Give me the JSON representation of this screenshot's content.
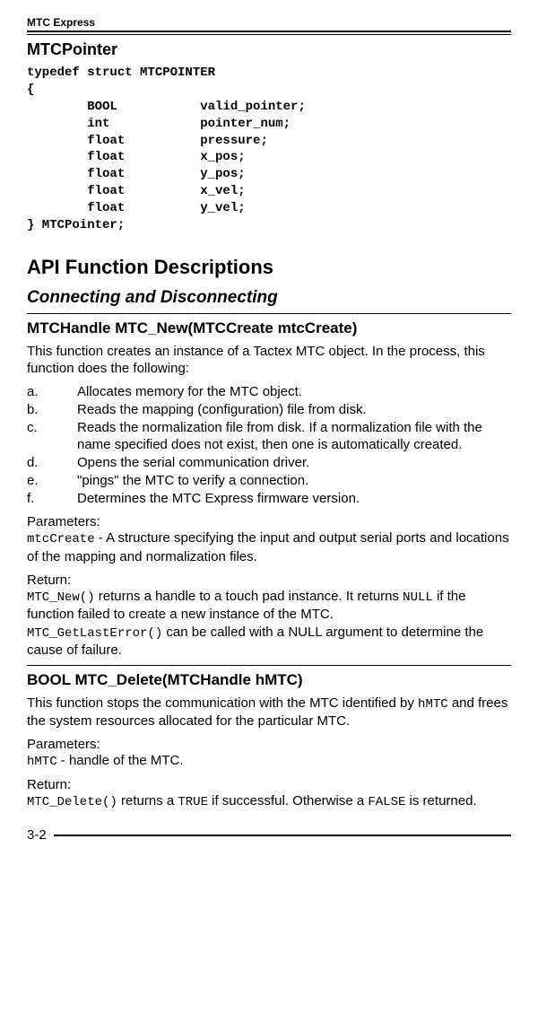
{
  "running_head": "MTC Express",
  "struct": {
    "title": "MTCPointer",
    "code": "typedef struct MTCPOINTER\n{\n        BOOL           valid_pointer;\n        int            pointer_num;\n        float          pressure;\n        float          x_pos;\n        float          y_pos;\n        float          x_vel;\n        float          y_vel;\n} MTCPointer;"
  },
  "h1": "API Function Descriptions",
  "h2": "Connecting and Disconnecting",
  "func1": {
    "title": "MTCHandle MTC_New(MTCCreate mtcCreate)",
    "intro": "This function creates an instance of a Tactex MTC object.  In the process, this function does the following:",
    "items": {
      "a_label": "a.",
      "a_text": "Allocates memory for the MTC object.",
      "b_label": "b.",
      "b_text": "Reads the mapping (configuration) file from disk.",
      "c_label": "c.",
      "c_text": "Reads the normalization file from disk.  If a normalization file with the name specified does not exist, then one is automatically created.",
      "d_label": "d.",
      "d_text": "Opens the serial communication driver.",
      "e_label": "e.",
      "e_text": "\"pings\" the MTC to verify a connection.",
      "f_label": "f.",
      "f_text": "Determines the MTC Express firmware version."
    },
    "params_label": "Parameters:",
    "params_code": "mtcCreate",
    "params_text": " - A structure specifying the input and output serial ports and locations of the mapping and normalization files.",
    "return_label": "Return:",
    "return_code1": "MTC_New()",
    "return_text1": " returns a handle to a touch pad instance.  It returns ",
    "return_null": "NULL",
    "return_text1b": " if the function failed to create a new instance of the MTC.",
    "return_code2": "MTC_GetLastError()",
    "return_text2": " can be called with a NULL argument to determine the cause of failure."
  },
  "func2": {
    "title": "BOOL MTC_Delete(MTCHandle hMTC)",
    "intro1": "This function stops the communication with the MTC identified by ",
    "intro_code": "hMTC",
    "intro2": " and frees the system resources allocated for the particular MTC.",
    "params_label": "Parameters:",
    "params_code": "hMTC",
    "params_text": " - handle of the MTC.",
    "return_label": "Return:",
    "return_code": "MTC_Delete()",
    "return_text1": " returns a ",
    "return_true": "TRUE",
    "return_text2": " if successful. Otherwise a ",
    "return_false": "FALSE",
    "return_text3": " is returned."
  },
  "page_number": "3-2"
}
